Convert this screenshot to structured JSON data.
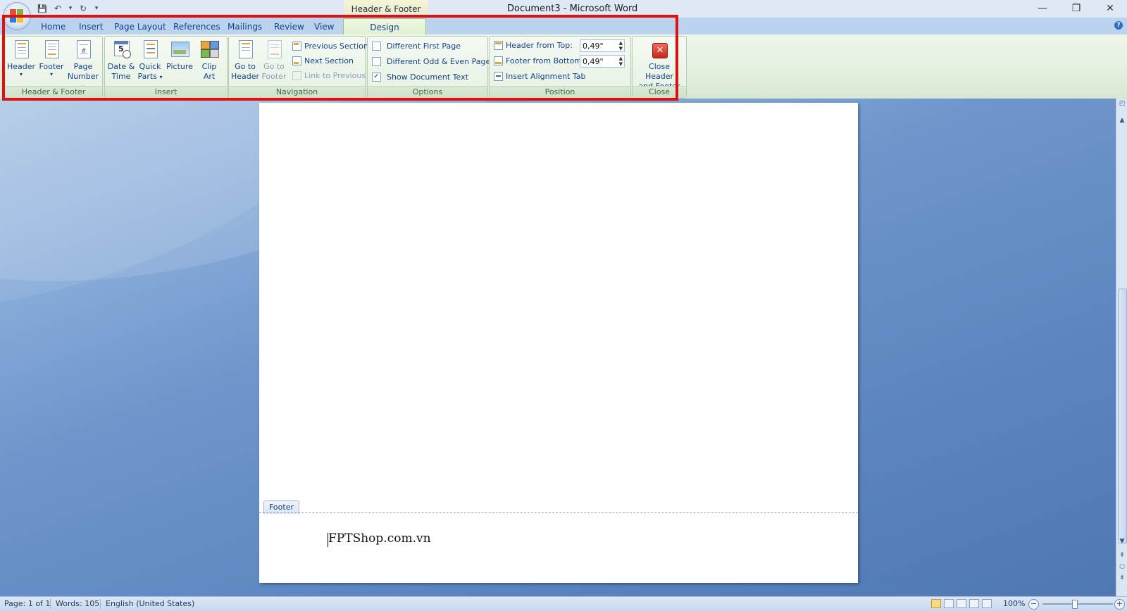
{
  "window": {
    "tools_context": "Header & Footer Tools",
    "title": "Document3 - Microsoft Word",
    "minimize": "—",
    "restore": "❐",
    "close": "✕"
  },
  "qat": {
    "save": "💾",
    "undo": "↶",
    "undo_drop": "▾",
    "redo": "↻",
    "customize": "▾"
  },
  "tabs": {
    "home": "Home",
    "insert": "Insert",
    "page_layout": "Page Layout",
    "references": "References",
    "mailings": "Mailings",
    "review": "Review",
    "view": "View",
    "design": "Design"
  },
  "ribbon": {
    "header_footer": {
      "label": "Header & Footer",
      "header": "Header",
      "footer": "Footer",
      "page_number_1": "Page",
      "page_number_2": "Number",
      "arrow": "▾"
    },
    "insert": {
      "label": "Insert",
      "date_time_1": "Date &",
      "date_time_2": "Time",
      "quick_parts_1": "Quick",
      "quick_parts_2": "Parts",
      "picture": "Picture",
      "clip_art_1": "Clip",
      "clip_art_2": "Art"
    },
    "navigation": {
      "label": "Navigation",
      "go_to_header_1": "Go to",
      "go_to_header_2": "Header",
      "go_to_footer_1": "Go to",
      "go_to_footer_2": "Footer",
      "previous_section": "Previous Section",
      "next_section": "Next Section",
      "link_to_previous": "Link to Previous"
    },
    "options": {
      "label": "Options",
      "different_first_page": "Different First Page",
      "different_odd_even": "Different Odd & Even Pages",
      "show_document_text": "Show Document Text",
      "check_mark": "✓"
    },
    "position": {
      "label": "Position",
      "header_from_top": "Header from Top:",
      "header_from_top_value": "0,49\"",
      "footer_from_bottom": "Footer from Bottom:",
      "footer_from_bottom_value": "0,49\"",
      "insert_alignment_tab": "Insert Alignment Tab",
      "spin_up": "▲",
      "spin_down": "▼"
    },
    "close": {
      "label": "Close",
      "close_hf_1": "Close Header",
      "close_hf_2": "and Footer"
    }
  },
  "document": {
    "footer_tag": "Footer",
    "footer_text": "FPTShop.com.vn"
  },
  "status": {
    "page": "Page: 1 of 1",
    "words": "Words: 105",
    "language": "English (United States)",
    "zoom": "100%",
    "zoom_out": "−",
    "zoom_in": "+"
  },
  "colors": {
    "highlight": "#e01010",
    "accent": "#15428b"
  }
}
